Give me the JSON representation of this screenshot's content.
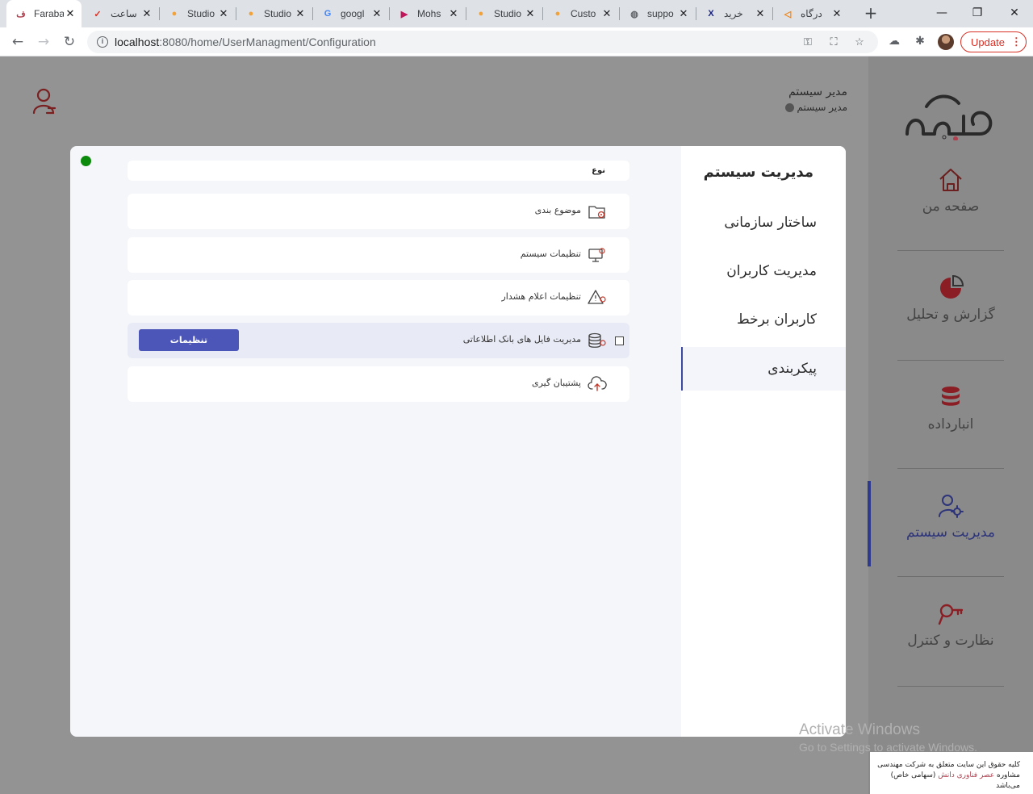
{
  "browser": {
    "tabs": [
      {
        "title": "Faraba",
        "icon": "farabar-favicon-icon",
        "icon_char": "ف",
        "icon_color": "#b0404e",
        "active": true
      },
      {
        "title": "ساعت",
        "icon": "checkmark-favicon-icon",
        "icon_char": "✓",
        "icon_color": "#d93025"
      },
      {
        "title": "Studio",
        "icon": "studio-favicon-icon",
        "icon_char": "●",
        "icon_color": "#f2a23a"
      },
      {
        "title": "Studio",
        "icon": "studio-favicon-icon",
        "icon_char": "●",
        "icon_color": "#f2a23a"
      },
      {
        "title": "googl",
        "icon": "google-favicon-icon",
        "icon_char": "G",
        "icon_color": "#4285f4"
      },
      {
        "title": "Mohs",
        "icon": "play-favicon-icon",
        "icon_char": "▶",
        "icon_color": "#c2185b"
      },
      {
        "title": "Studio",
        "icon": "studio-favicon-icon",
        "icon_char": "●",
        "icon_color": "#f2a23a"
      },
      {
        "title": "Custo",
        "icon": "studio-favicon-icon",
        "icon_char": "●",
        "icon_color": "#f2a23a"
      },
      {
        "title": "suppo",
        "icon": "globe-favicon-icon",
        "icon_char": "◍",
        "icon_color": "#5f6368"
      },
      {
        "title": "خرید",
        "icon": "x-favicon-icon",
        "icon_char": "X",
        "icon_color": "#1a237e"
      },
      {
        "title": "درگاه",
        "icon": "arrow-favicon-icon",
        "icon_char": "◁",
        "icon_color": "#f57c00"
      }
    ],
    "url_host": "localhost",
    "url_path": ":8080/home/UserManagment/Configuration",
    "update_label": "Update",
    "accent_color": "#d93025"
  },
  "header": {
    "user_name": "مدیر سیستم",
    "user_role": "مدیر سیستم"
  },
  "rail": {
    "items": [
      {
        "label": "صفحه من",
        "icon": "home-icon"
      },
      {
        "label": "گزارش و تحلیل",
        "icon": "pie-chart-icon"
      },
      {
        "label": "انبارداده",
        "icon": "database-icon"
      },
      {
        "label": "مدیریت سیستم",
        "icon": "user-settings-icon",
        "active": true
      },
      {
        "label": "نظارت و کنترل",
        "icon": "magnifier-key-icon"
      }
    ]
  },
  "modal": {
    "side_title": "مدیریت سیستم",
    "side_items": [
      {
        "label": "ساختار سازمانی"
      },
      {
        "label": "مدیریت کاربران"
      },
      {
        "label": "کاربران برخط"
      },
      {
        "label": "پیکربندی",
        "active": true
      }
    ],
    "type_header": "نوع",
    "rows": [
      {
        "label": "موضوع بندی",
        "icon": "folder-gear-icon"
      },
      {
        "label": "تنظیمات سیستم",
        "icon": "monitor-gear-icon"
      },
      {
        "label": "تنظیمات اعلام هشدار",
        "icon": "warning-gear-icon"
      },
      {
        "label": "مدیریت فایل های بانک اطلاعاتی",
        "icon": "database-gear-icon",
        "selected": true,
        "button_label": "تنظیمات"
      },
      {
        "label": "پشتیبان گیری",
        "icon": "cloud-upload-icon"
      }
    ],
    "status_color": "#0b8a0b",
    "button_color": "#4c55b8"
  },
  "watermark": {
    "line1": "Activate Windows",
    "line2": "Go to Settings to activate Windows."
  },
  "footer": {
    "line1": "کلیه حقوق این سایت متعلق به شرکت مهندسی",
    "line2_prefix": "مشاوره",
    "line2_highlight": "عصر فناوری دانش",
    "line2_suffix": "(سهامی خاص) می‌باشد"
  }
}
